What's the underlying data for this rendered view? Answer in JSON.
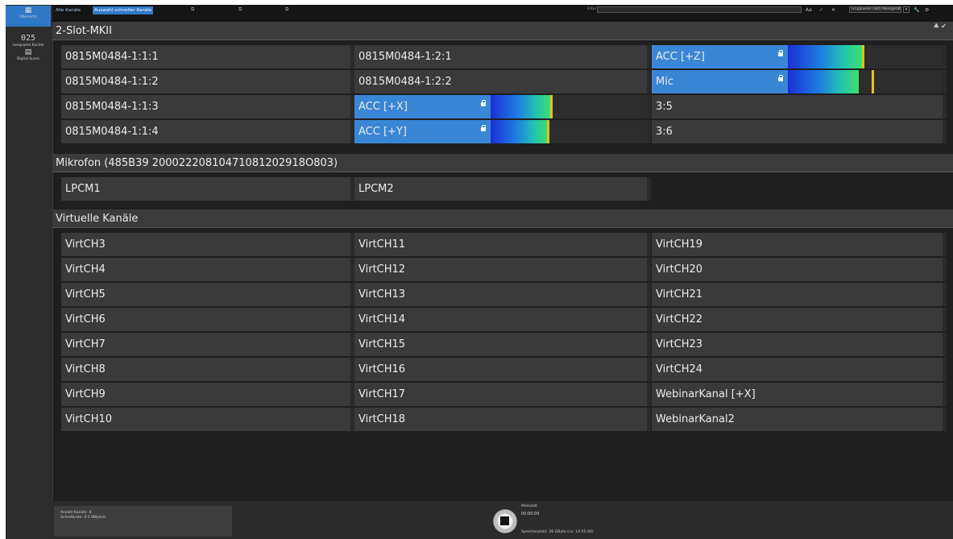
{
  "sidebar": {
    "items": [
      {
        "label": "Übersicht",
        "icon": "grid-icon"
      },
      {
        "label": "Langsame Kanäle",
        "display": "025",
        "icon": "slow-channels-icon"
      },
      {
        "label": "Digital buses",
        "icon": "bus-icon"
      }
    ]
  },
  "toolbar": {
    "tabs": [
      "Alle Kanäle",
      "Auswahl schneller Kanäle"
    ],
    "filter_label": "Filter",
    "filter_value": "",
    "match_case": "Aa",
    "group_select": "Gruppieren nach Messgerät"
  },
  "sections": [
    {
      "title": "2-Slot-MKII",
      "rows": [
        [
          {
            "name": "0815M0484-1:1:1"
          },
          {
            "name": "0815M0484-1:2:1"
          },
          {
            "name": "ACC [+Z]",
            "active": true,
            "level": 0.48,
            "peak": 0.49
          }
        ],
        [
          {
            "name": "0815M0484-1:1:2"
          },
          {
            "name": "0815M0484-1:2:2"
          },
          {
            "name": "Mic",
            "active": true,
            "level": 0.46,
            "peak": 0.55
          }
        ],
        [
          {
            "name": "0815M0484-1:1:3"
          },
          {
            "name": "ACC [+X]",
            "active": true,
            "level": 0.39,
            "peak": 0.39
          },
          {
            "name": "3:5"
          }
        ],
        [
          {
            "name": "0815M0484-1:1:4"
          },
          {
            "name": "ACC [+Y]",
            "active": true,
            "level": 0.37,
            "peak": 0.37
          },
          {
            "name": "3:6"
          }
        ]
      ]
    },
    {
      "title": "Mikrofon (485B39 20002220810471081202918O803)",
      "rows": [
        [
          {
            "name": "LPCM1"
          },
          {
            "name": "LPCM2"
          }
        ]
      ]
    },
    {
      "title": "Virtuelle Kanäle",
      "rows": [
        [
          {
            "name": "VirtCH3"
          },
          {
            "name": "VirtCH11"
          },
          {
            "name": "VirtCH19"
          }
        ],
        [
          {
            "name": "VirtCH4"
          },
          {
            "name": "VirtCH12"
          },
          {
            "name": "VirtCH20"
          }
        ],
        [
          {
            "name": "VirtCH5"
          },
          {
            "name": "VirtCH13"
          },
          {
            "name": "VirtCH21"
          }
        ],
        [
          {
            "name": "VirtCH6"
          },
          {
            "name": "VirtCH14"
          },
          {
            "name": "VirtCH22"
          }
        ],
        [
          {
            "name": "VirtCH7"
          },
          {
            "name": "VirtCH15"
          },
          {
            "name": "VirtCH23"
          }
        ],
        [
          {
            "name": "VirtCH8"
          },
          {
            "name": "VirtCH16"
          },
          {
            "name": "VirtCH24"
          }
        ],
        [
          {
            "name": "VirtCH9"
          },
          {
            "name": "VirtCH17"
          },
          {
            "name": "WebinarKanal [+X]"
          }
        ],
        [
          {
            "name": "VirtCH10"
          },
          {
            "name": "VirtCH18"
          },
          {
            "name": "WebinarKanal2"
          }
        ]
      ]
    }
  ],
  "status": {
    "channel_count": "Anzahl Kanäle: 4",
    "write_rate": "Schreibrate: 0.5 MByte/s",
    "measure_label": "Messzeit",
    "measure_time": "00:00:09",
    "storage": "Speicherplatz: 26 GByte (ca. 14:55:40)"
  },
  "colors": {
    "accent": "#2f78c8",
    "channel_active": "#3a86d6",
    "peak": "#e2c21a"
  }
}
